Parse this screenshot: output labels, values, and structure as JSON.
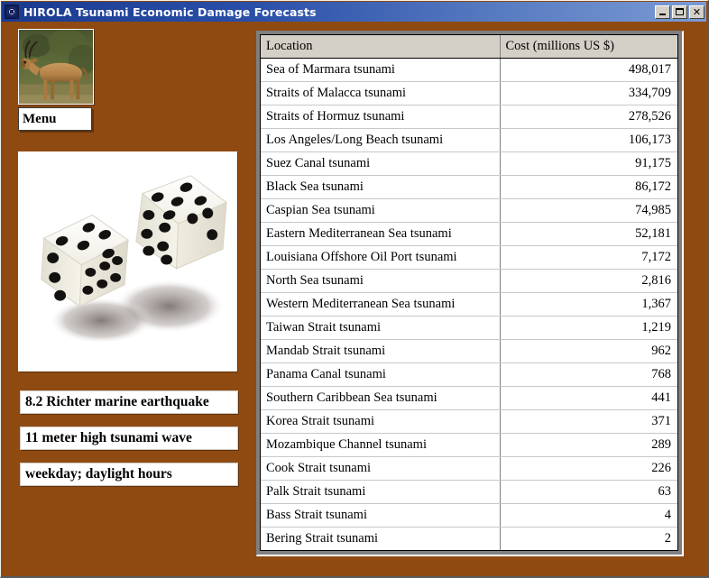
{
  "window": {
    "title": "HIROLA Tsunami Economic Damage Forecasts",
    "icon": "app-icon",
    "background_color": "#8f4a12",
    "titlebar_color": "#1a3a8f",
    "controls": {
      "minimize": "_",
      "maximize": "□",
      "close": "✕"
    }
  },
  "sidebar": {
    "photo": {
      "alt": "hirola antelope photograph",
      "icon": "antelope-photo"
    },
    "menu_button": {
      "label": "Menu"
    },
    "dice_image": {
      "alt": "two white dice with black pips",
      "icon": "dice-photo"
    },
    "fields": [
      {
        "value": "8.2 Richter marine earthquake"
      },
      {
        "value": "11 meter high tsunami wave"
      },
      {
        "value": "weekday; daylight hours"
      }
    ]
  },
  "table": {
    "columns": [
      {
        "key": "location",
        "label": "Location"
      },
      {
        "key": "cost",
        "label": "Cost (millions US $)"
      }
    ],
    "rows": [
      {
        "location": "Sea of Marmara tsunami",
        "cost": "498,017"
      },
      {
        "location": "Straits of Malacca tsunami",
        "cost": "334,709"
      },
      {
        "location": "Straits of Hormuz tsunami",
        "cost": "278,526"
      },
      {
        "location": "Los Angeles/Long Beach tsunami",
        "cost": "106,173"
      },
      {
        "location": "Suez Canal tsunami",
        "cost": "91,175"
      },
      {
        "location": "Black Sea tsunami",
        "cost": "86,172"
      },
      {
        "location": "Caspian Sea tsunami",
        "cost": "74,985"
      },
      {
        "location": "Eastern Mediterranean Sea tsunami",
        "cost": "52,181"
      },
      {
        "location": "Louisiana Offshore Oil Port tsunami",
        "cost": "7,172"
      },
      {
        "location": "North Sea tsunami",
        "cost": "2,816"
      },
      {
        "location": "Western Mediterranean Sea tsunami",
        "cost": "1,367"
      },
      {
        "location": "Taiwan Strait tsunami",
        "cost": "1,219"
      },
      {
        "location": "Mandab Strait tsunami",
        "cost": "962"
      },
      {
        "location": "Panama Canal tsunami",
        "cost": "768"
      },
      {
        "location": "Southern Caribbean Sea tsunami",
        "cost": "441"
      },
      {
        "location": "Korea Strait tsunami",
        "cost": "371"
      },
      {
        "location": "Mozambique Channel tsunami",
        "cost": "289"
      },
      {
        "location": "Cook Strait tsunami",
        "cost": "226"
      },
      {
        "location": "Palk Strait tsunami",
        "cost": "63"
      },
      {
        "location": "Bass Strait tsunami",
        "cost": "4"
      },
      {
        "location": "Bering Strait tsunami",
        "cost": "2"
      }
    ]
  }
}
